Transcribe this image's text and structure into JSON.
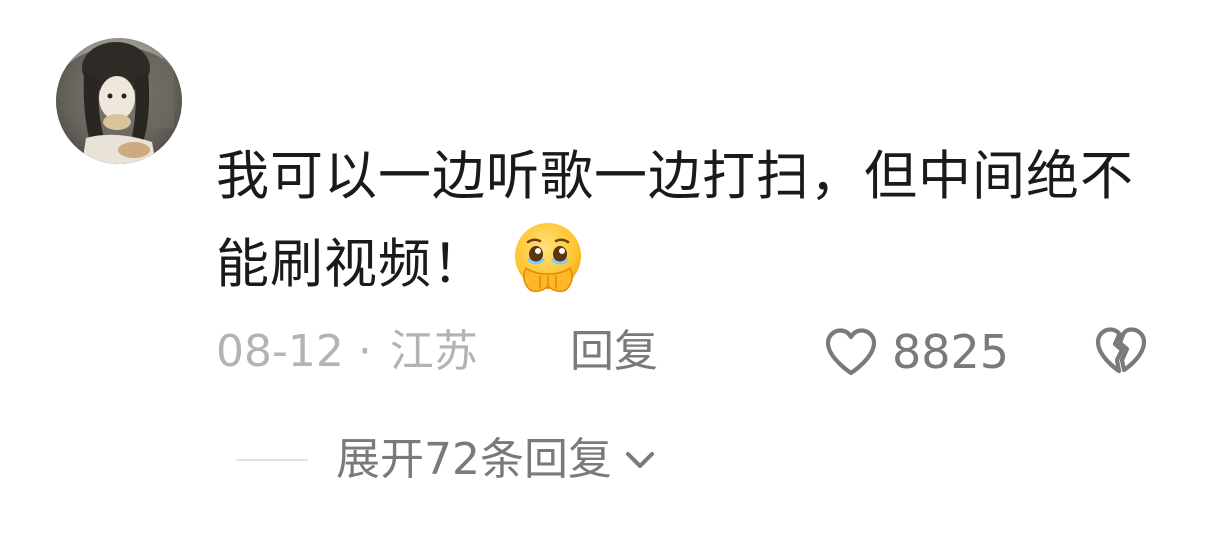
{
  "comment": {
    "text": "我可以一边听歌一边打扫，但中间绝不能刷视频！",
    "emoji_icon": "holding-back-tears-emoji"
  },
  "meta": {
    "date": "08-12",
    "separator": "·",
    "location": "江苏",
    "reply_label": "回复"
  },
  "actions": {
    "like_icon": "heart-outline-icon",
    "like_count": "8825",
    "dislike_icon": "broken-heart-icon"
  },
  "replies": {
    "expand_label": "展开72条回复",
    "expand_icon": "chevron-down-icon"
  },
  "colors": {
    "text_primary": "#1a1a1a",
    "text_secondary": "#7a7a7a",
    "text_muted": "#b3b3b3",
    "divider": "#e3e3e3"
  }
}
